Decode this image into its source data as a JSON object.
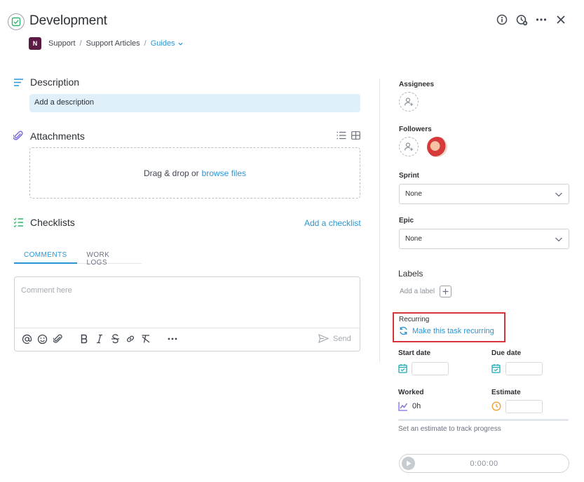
{
  "header": {
    "title": "Development",
    "project_badge": "N",
    "breadcrumb": [
      "Support",
      "Support Articles",
      "Guides"
    ],
    "breadcrumb_sep": "/"
  },
  "description": {
    "title": "Description",
    "placeholder": "Add a description"
  },
  "attachments": {
    "title": "Attachments",
    "drop_text": "Drag & drop or",
    "browse_link": "browse files"
  },
  "checklists": {
    "title": "Checklists",
    "add_link": "Add a checklist"
  },
  "tabs": [
    {
      "label": "COMMENTS",
      "active": true
    },
    {
      "label": "WORK LOGS",
      "active": false
    }
  ],
  "comment": {
    "placeholder": "Comment here",
    "send_label": "Send"
  },
  "sidebar": {
    "assignees_label": "Assignees",
    "followers_label": "Followers",
    "sprint_label": "Sprint",
    "sprint_value": "None",
    "epic_label": "Epic",
    "epic_value": "None",
    "labels_title": "Labels",
    "labels_add": "Add a label",
    "recurring_label": "Recurring",
    "recurring_link": "Make this task recurring",
    "start_date_label": "Start date",
    "due_date_label": "Due date",
    "worked_label": "Worked",
    "worked_value": "0h",
    "estimate_label": "Estimate",
    "progress_hint": "Set an estimate to track progress",
    "timer_value": "0:00:00"
  },
  "colors": {
    "accent": "#2a95d5",
    "highlight": "#d6353b",
    "description_bg": "#dff0fb",
    "project_badge": "#5b1b44"
  },
  "icons": [
    "check-circle-icon",
    "info-icon",
    "clock-add-icon",
    "more-icon",
    "close-icon",
    "paperclip-icon",
    "list-view-icon",
    "grid-view-icon",
    "checklist-icon",
    "at-icon",
    "emoji-icon",
    "bold-icon",
    "italic-icon",
    "strikethrough-icon",
    "link-icon",
    "clear-format-icon",
    "send-icon",
    "add-person-icon",
    "chevron-down-icon",
    "plus-icon",
    "recurring-icon",
    "calendar-icon",
    "chart-icon",
    "clock-icon",
    "play-icon"
  ]
}
